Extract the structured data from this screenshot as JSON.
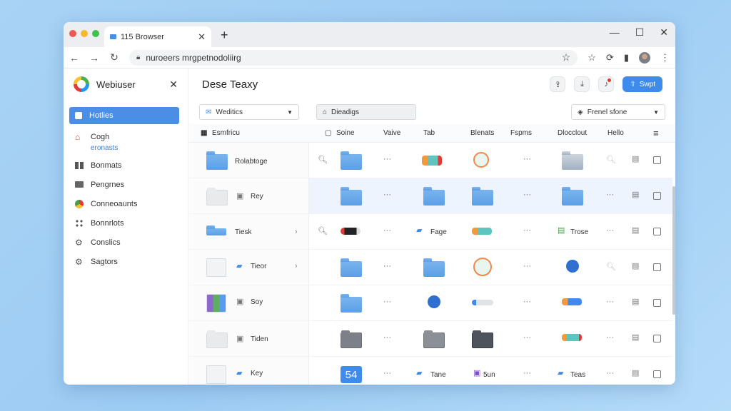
{
  "browser": {
    "tab_title": "115 Browser",
    "url": "nuroeers mrgpetnodoliirg"
  },
  "sidebar": {
    "title": "Webiuser",
    "items": [
      {
        "label": "Hotlies",
        "icon": "home-icon",
        "active": true
      },
      {
        "label": "Cogh",
        "sub": "eronasts",
        "icon": "house-icon"
      },
      {
        "label": "Bonmats",
        "icon": "bookmark-icon"
      },
      {
        "label": "Pengrnes",
        "icon": "folder-icon"
      },
      {
        "label": "Conneoaunts",
        "icon": "chrome-icon"
      },
      {
        "label": "Bonnrlots",
        "icon": "grid-icon"
      },
      {
        "label": "Conslics",
        "icon": "gear-icon"
      },
      {
        "label": "Sagtors",
        "icon": "settings-icon"
      }
    ]
  },
  "main": {
    "title": "Dese Teaxy",
    "primary_label": "Swpt",
    "filters": {
      "left": "Weditics",
      "middle": "Dieadigs",
      "right": "Frenel sfone"
    },
    "columns": [
      "Esmfricu",
      "Soine",
      "Vaive",
      "Tab",
      "Blenats",
      "Fspms",
      "Dlocclout",
      "Hello"
    ],
    "rows": [
      {
        "name": "Rolabtoge"
      },
      {
        "name": "Rey"
      },
      {
        "name": "Tiesk",
        "cells": {
          "fage": "Fage",
          "trose": "Trose"
        }
      },
      {
        "name": "Tieor"
      },
      {
        "name": "Soy"
      },
      {
        "name": "Tiden"
      },
      {
        "name": "Key",
        "cells": {
          "badge": "54",
          "tane": "Tane",
          "sun": "5un",
          "teas": "Teas"
        }
      }
    ]
  },
  "colors": {
    "accent": "#3f8bec",
    "sidebar_active": "#4a8ee6",
    "folder_blue": "#5c9fe6"
  }
}
